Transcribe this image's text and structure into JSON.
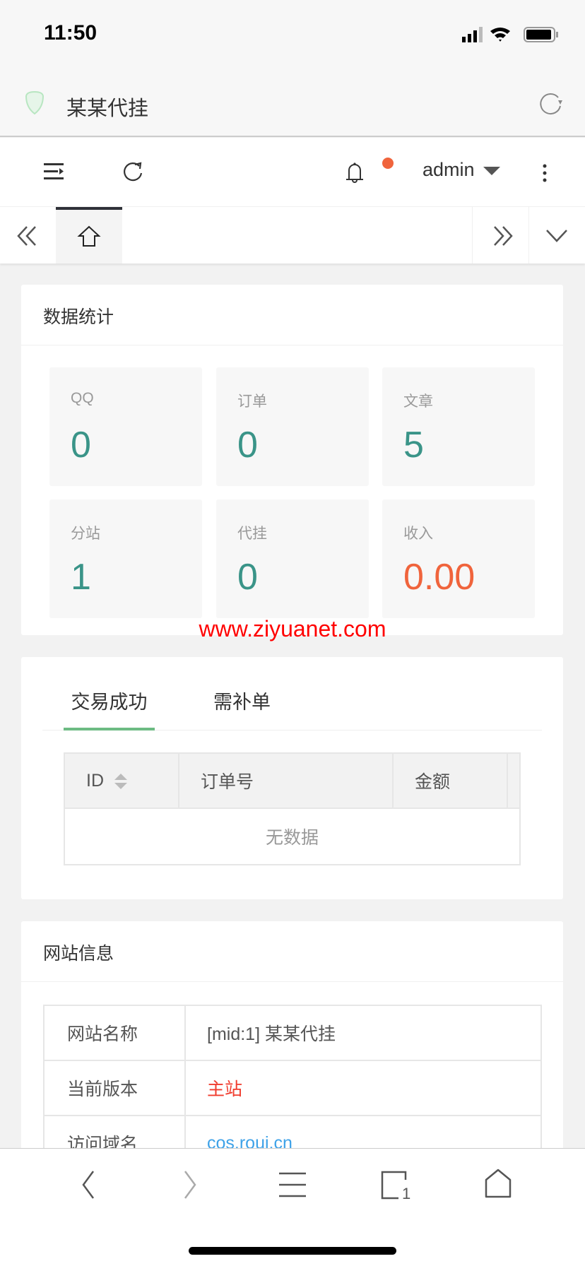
{
  "status_bar": {
    "time": "11:50"
  },
  "browser": {
    "title": "某某代挂"
  },
  "header": {
    "user": "admin"
  },
  "stats_card": {
    "title": "数据统计",
    "items": [
      {
        "label": "QQ",
        "value": "0",
        "color": "#3a9488"
      },
      {
        "label": "订单",
        "value": "0",
        "color": "#3a9488"
      },
      {
        "label": "文章",
        "value": "5",
        "color": "#3a9488"
      },
      {
        "label": "分站",
        "value": "1",
        "color": "#3a9488"
      },
      {
        "label": "代挂",
        "value": "0",
        "color": "#3a9488"
      },
      {
        "label": "收入",
        "value": "0.00",
        "color": "#f0643c"
      }
    ]
  },
  "watermark": "www.ziyuanet.com",
  "orders_card": {
    "tabs": [
      "交易成功",
      "需补单"
    ],
    "columns": [
      "ID",
      "订单号",
      "金额"
    ],
    "empty": "无数据"
  },
  "site_card": {
    "title": "网站信息",
    "rows": [
      {
        "label": "网站名称",
        "value": "[mid:1] 某某代挂"
      },
      {
        "label": "当前版本",
        "value": "主站"
      },
      {
        "label": "访问域名",
        "value": "cos.roui.cn"
      }
    ]
  }
}
